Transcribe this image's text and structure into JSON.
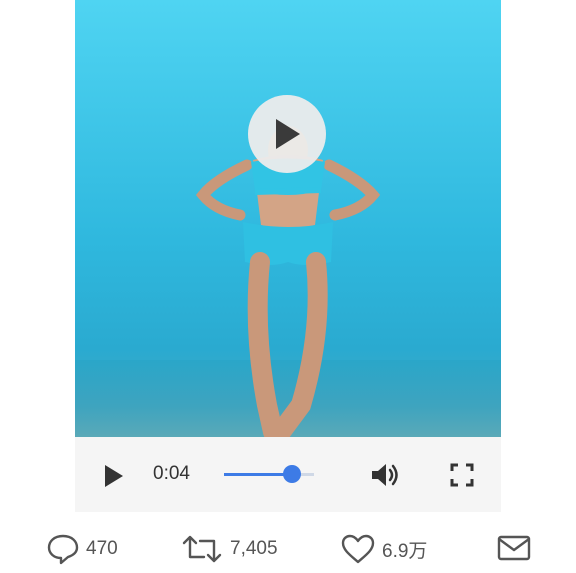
{
  "player": {
    "current_time": "0:04",
    "progress": 0.75
  },
  "actions": {
    "reply_count": "470",
    "retweet_count": "7,405",
    "like_count": "6.9万"
  },
  "icons": {
    "play_large": "play-icon",
    "play_control": "play-icon",
    "volume": "volume-icon",
    "fullscreen": "fullscreen-icon",
    "reply": "comment-icon",
    "retweet": "retweet-icon",
    "like": "heart-icon",
    "message": "envelope-icon"
  },
  "colors": {
    "accent": "#3d7be6",
    "video_bg": "#3ec3e6",
    "icon_gray": "#555555"
  }
}
